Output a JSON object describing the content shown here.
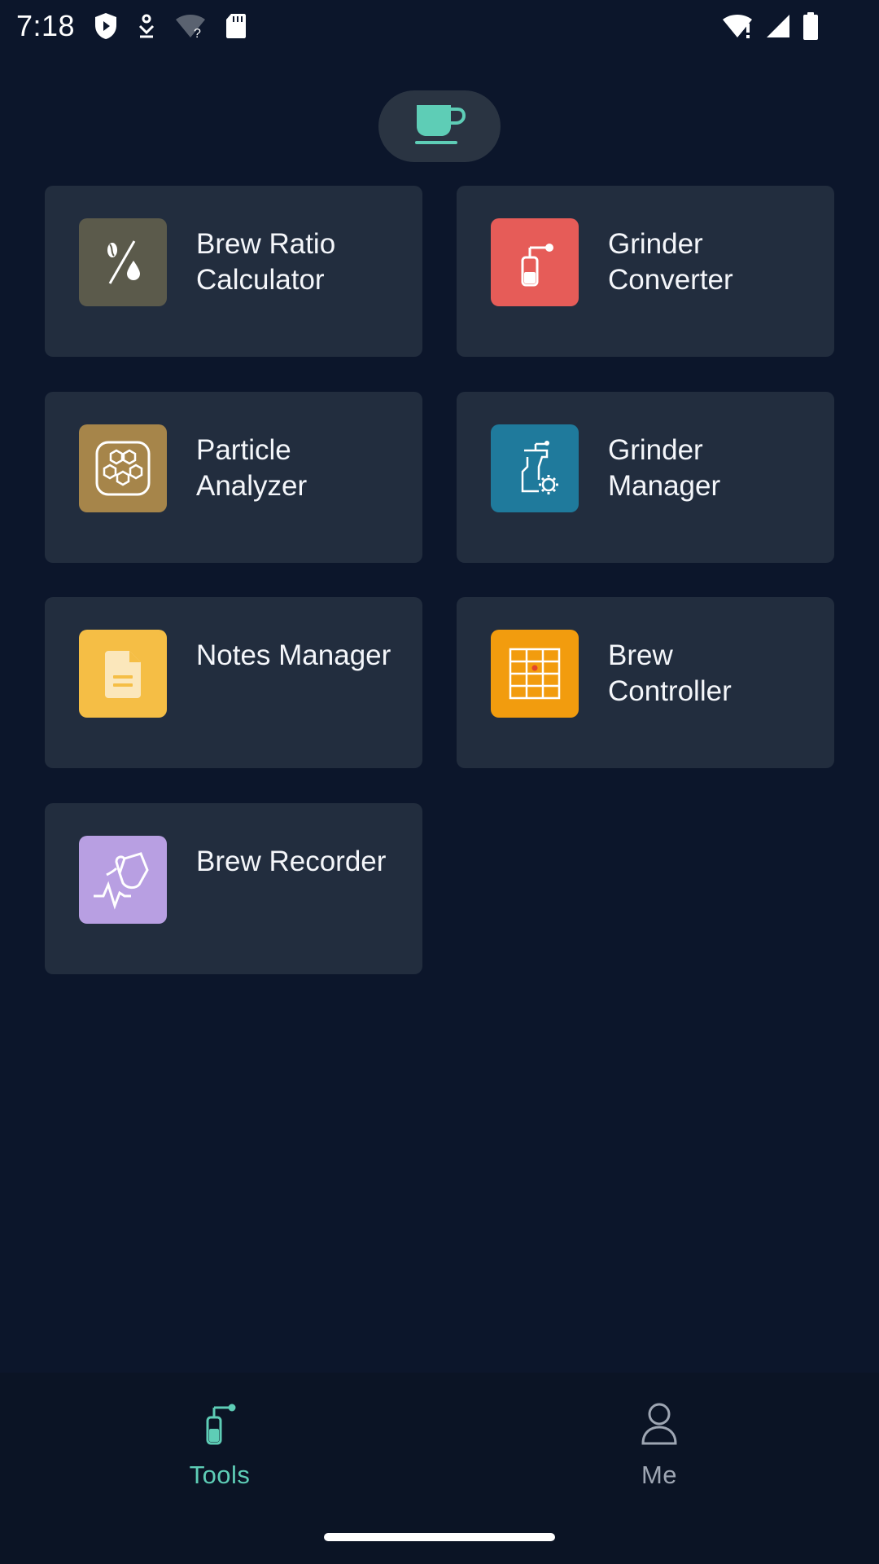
{
  "status_bar": {
    "time": "7:18",
    "left_icons": [
      "shield-play-icon",
      "download-person-icon",
      "wifi-question-icon",
      "sd-card-icon"
    ],
    "right_icons": [
      "wifi-alert-icon",
      "signal-icon",
      "battery-icon"
    ]
  },
  "header": {
    "icon": "coffee-cup-icon",
    "accent_color": "#5ecdb6"
  },
  "tools": [
    {
      "label": "Brew Ratio Calculator",
      "icon": "percent-drop-icon",
      "color": "#5b5a4b"
    },
    {
      "label": "Grinder Converter",
      "icon": "grinder-icon",
      "color": "#e65c58"
    },
    {
      "label": "Particle Analyzer",
      "icon": "hexagon-particles-icon",
      "color": "#a6854a"
    },
    {
      "label": "Grinder Manager",
      "icon": "grinder-gear-icon",
      "color": "#1f7a9c"
    },
    {
      "label": "Notes Manager",
      "icon": "document-icon",
      "color": "#f5be45"
    },
    {
      "label": "Brew Controller",
      "icon": "grid-icon",
      "color": "#f29c0e"
    },
    {
      "label": "Brew Recorder",
      "icon": "pour-pulse-icon",
      "color": "#b89fe2"
    }
  ],
  "bottom_nav": {
    "items": [
      {
        "label": "Tools",
        "icon": "grinder-tool-icon",
        "active": true
      },
      {
        "label": "Me",
        "icon": "person-icon",
        "active": false
      }
    ],
    "active_color": "#5ecdb6",
    "inactive_color": "#9ea6b3"
  }
}
